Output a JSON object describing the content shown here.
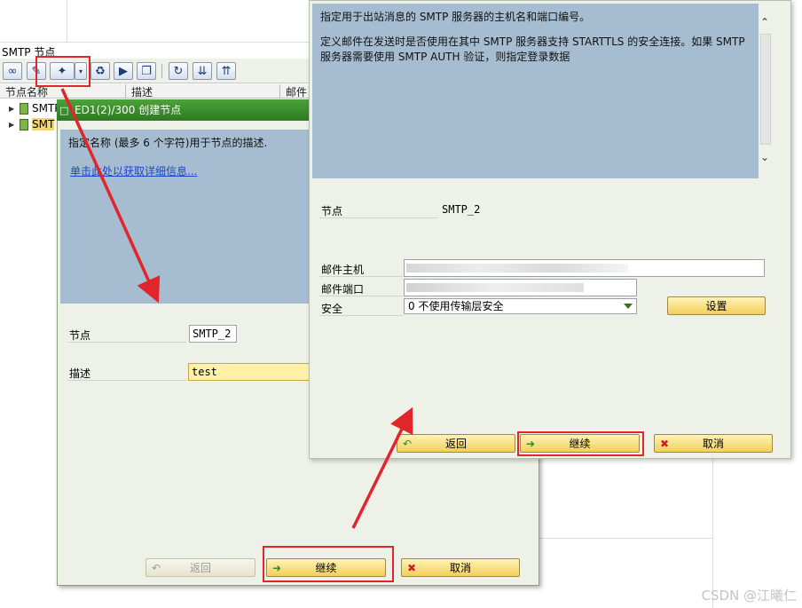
{
  "background_window": {
    "title": "SMTP 节点",
    "columns": [
      "节点名称",
      "描述",
      "邮件"
    ],
    "tree_items": [
      "SMTP",
      "SMT"
    ]
  },
  "create_dialog": {
    "title": "ED1(2)/300 创建节点",
    "info_text": "指定名称 (最多 6 个字符)用于节点的描述.",
    "info_link": "单击此处以获取详细信息...",
    "node_label": "节点",
    "node_value": "SMTP_2",
    "desc_label": "描述",
    "desc_value": "test",
    "buttons": {
      "back": "返回",
      "continue": "继续",
      "cancel": "取消"
    }
  },
  "smtp_dialog": {
    "info_line1": "指定用于出站消息的 SMTP 服务器的主机名和端口编号。",
    "info_line2": "定义邮件在发送时是否使用在其中 SMTP 服务器支持 STARTTLS 的安全连接。如果 SMTP 服务器需要使用 SMTP AUTH 验证，则指定登录数据",
    "node_label": "节点",
    "node_value": "SMTP_2",
    "mail_host_label": "邮件主机",
    "mail_port_label": "邮件端口",
    "security_label": "安全",
    "security_value": "0 不使用传输层安全",
    "settings_button": "设置",
    "buttons": {
      "back": "返回",
      "continue": "继续",
      "cancel": "取消"
    }
  },
  "watermark": "CSDN @江曦仁",
  "colors": {
    "annotation_red": "#e0252b",
    "info_bg": "#a6bdd1",
    "dialog_bg": "#eef1e8",
    "title_green": "#3b8f2c",
    "button_yellow": "#f3cf5a"
  }
}
